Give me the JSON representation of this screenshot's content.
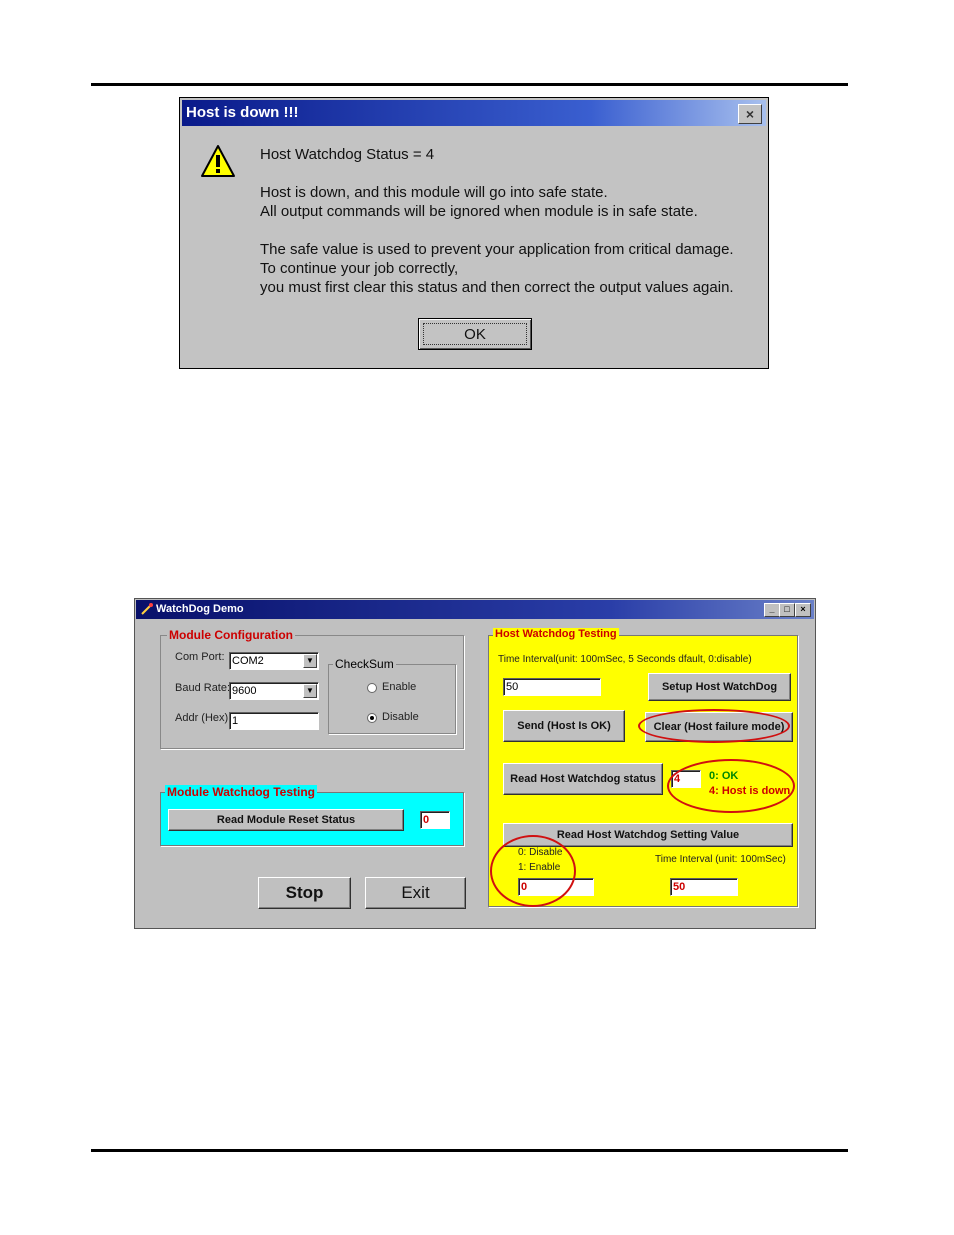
{
  "dialog": {
    "title": "Host is down !!!",
    "close_glyph": "×",
    "icon": "warning-icon",
    "status_line": "Host Watchdog Status = 4",
    "line1": "Host is down, and this module will go into safe state.",
    "line2": "All output commands will be ignored when module is in safe state.",
    "line3": "The safe value is used to prevent your application from critical damage.",
    "line4": "To continue your job correctly,",
    "line5": "you must first clear this status and then correct the output values again.",
    "ok_label": "OK"
  },
  "window": {
    "title": "WatchDog Demo",
    "min_glyph": "_",
    "max_glyph": "□",
    "close_glyph": "×",
    "module_config": {
      "title": "Module Configuration",
      "com_port_label": "Com Port:",
      "com_port_value": "COM2",
      "baud_rate_label": "Baud Rate:",
      "baud_rate_value": "9600",
      "addr_label": "Addr (Hex):",
      "addr_value": "1",
      "checksum": {
        "title": "CheckSum",
        "enable_label": "Enable",
        "disable_label": "Disable",
        "selected": "Disable"
      }
    },
    "module_watchdog": {
      "title": "Module Watchdog Testing",
      "read_reset_label": "Read Module Reset Status",
      "reset_status_value": "0"
    },
    "stop_label": "Stop",
    "exit_label": "Exit",
    "host_watchdog": {
      "title": "Host Watchdog Testing",
      "interval_hint": "Time Interval(unit: 100mSec, 5 Seconds dfault, 0:disable)",
      "interval_value": "50",
      "setup_label": "Setup Host WatchDog",
      "send_label": "Send (Host Is OK)",
      "clear_label": "Clear (Host failure mode)",
      "read_status_label": "Read Host Watchdog status",
      "status_value": "4",
      "status_ok_text": "0: OK",
      "status_down_text": "4: Host is down",
      "read_setting_label": "Read Host Watchdog Setting Value",
      "disable_hint": "0: Disable",
      "enable_hint": "1: Enable",
      "enable_value": "0",
      "interval_unit_label": "Time Interval (unit: 100mSec)",
      "interval_read_value": "50"
    }
  },
  "colors": {
    "host_panel": "#ffff00",
    "module_watchdog_panel": "#00ffff",
    "group_title_red": "#cc0000",
    "highlight_ellipse": "#d01010",
    "ok_green": "#008800"
  }
}
